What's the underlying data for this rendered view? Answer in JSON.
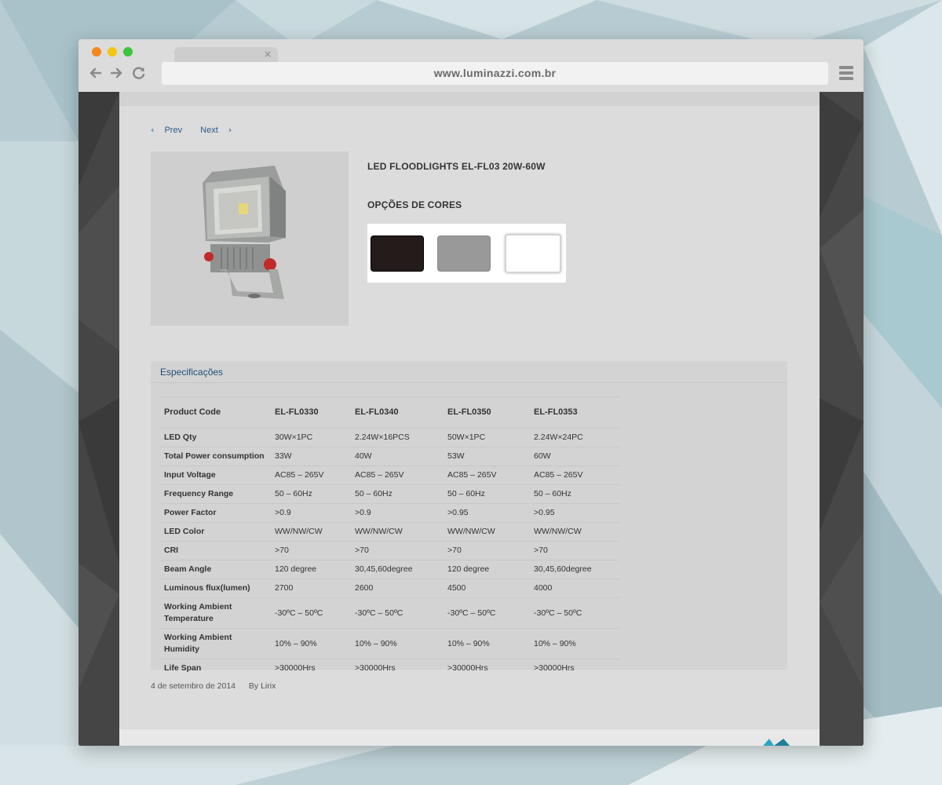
{
  "browser": {
    "url": "www.luminazzi.com.br",
    "tab_close": "×",
    "back_icon": "arrow-left-icon",
    "forward_icon": "arrow-right-icon",
    "reload_icon": "reload-icon",
    "menu_icon": "hamburger-menu-icon"
  },
  "pager": {
    "prev": "Prev",
    "next": "Next"
  },
  "product": {
    "title": "LED FLOODLIGHTS EL-FL03 20W-60W",
    "colors_title": "OPÇÕES DE CORES",
    "colors": [
      "#241b1b",
      "#999999",
      "#ffffff"
    ]
  },
  "specs": {
    "heading": "Especificações",
    "header": {
      "label": "Product Code",
      "cols": [
        "EL-FL0330",
        "EL-FL0340",
        "EL-FL0350",
        "EL-FL0353"
      ]
    },
    "rows": [
      {
        "label": "LED Qty",
        "values": [
          "30W×1PC",
          "2.24W×16PCS",
          "50W×1PC",
          "2.24W×24PC"
        ]
      },
      {
        "label": "Total Power consumption",
        "values": [
          "33W",
          "40W",
          "53W",
          "60W"
        ]
      },
      {
        "label": "Input Voltage",
        "values": [
          "AC85 – 265V",
          "AC85 – 265V",
          "AC85 – 265V",
          "AC85 – 265V"
        ]
      },
      {
        "label": "Frequency Range",
        "values": [
          "50 – 60Hz",
          "50 – 60Hz",
          "50 – 60Hz",
          "50 – 60Hz"
        ]
      },
      {
        "label": "Power Factor",
        "values": [
          ">0.9",
          ">0.9",
          ">0.95",
          ">0.95"
        ]
      },
      {
        "label": "LED Color",
        "values": [
          "WW/NW/CW",
          "WW/NW/CW",
          "WW/NW/CW",
          "WW/NW/CW"
        ]
      },
      {
        "label": "CRI",
        "values": [
          ">70",
          ">70",
          ">70",
          ">70"
        ]
      },
      {
        "label": "Beam Angle",
        "values": [
          "120 degree",
          "30,45,60degree",
          "120 degree",
          "30,45,60degree"
        ]
      },
      {
        "label": "Luminous flux(lumen)",
        "values": [
          "2700",
          "2600",
          "4500",
          "4000"
        ]
      },
      {
        "label": "Working Ambient Temperature",
        "values": [
          "-30ºC – 50ºC",
          "-30ºC – 50ºC",
          "-30ºC – 50ºC",
          "-30ºC – 50ºC"
        ]
      },
      {
        "label": "Working Ambient Humidity",
        "values": [
          "10% – 90%",
          "10% – 90%",
          "10% – 90%",
          "10% – 90%"
        ]
      },
      {
        "label": "Life Span",
        "values": [
          ">30000Hrs",
          ">30000Hrs",
          ">30000Hrs",
          ">30000Hrs"
        ]
      }
    ]
  },
  "meta": {
    "date": "4 de setembro de 2014",
    "author": "By Lirix"
  }
}
